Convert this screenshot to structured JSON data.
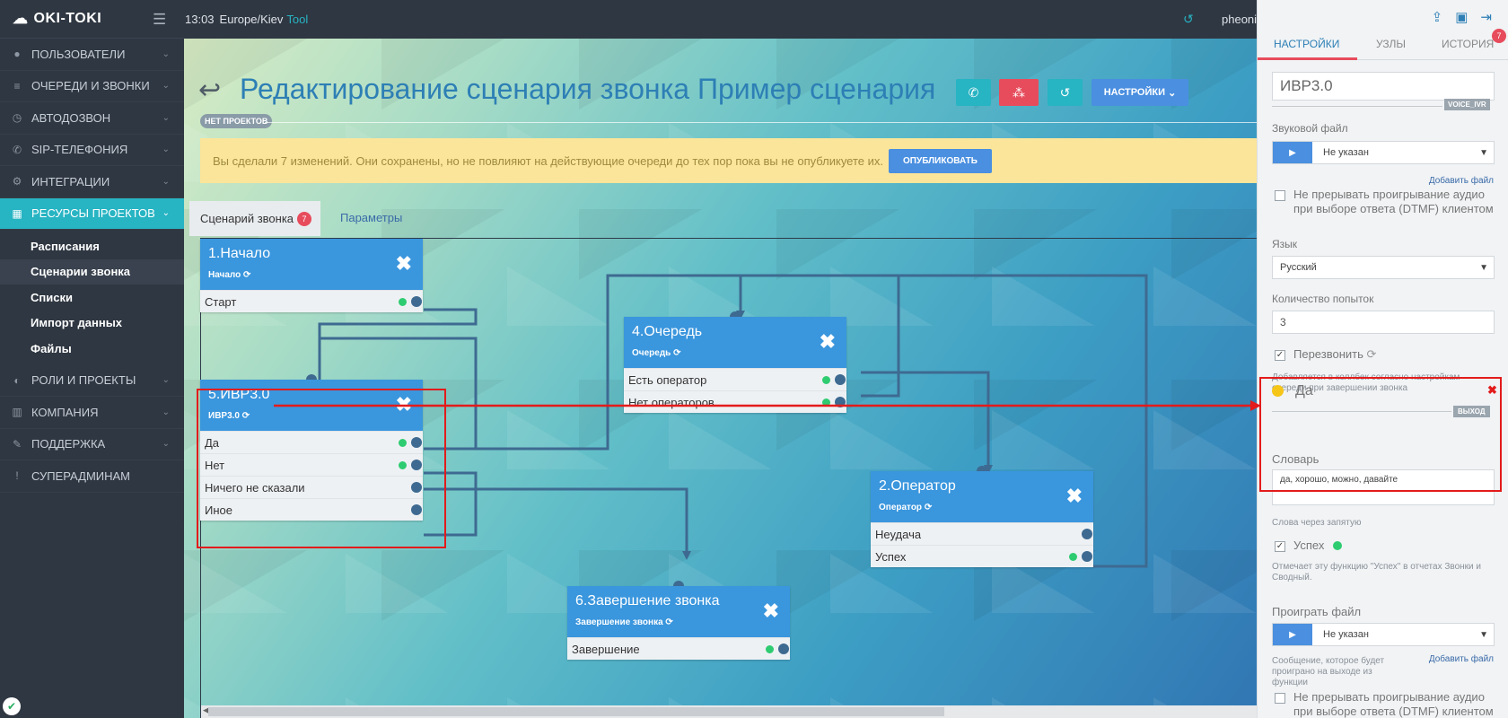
{
  "brand": "OKI-TOKI",
  "topbar": {
    "time": "13:03",
    "timezone": "Europe/Kiev",
    "tool": "Tool",
    "user": "pheoni"
  },
  "sidebar": {
    "items": [
      {
        "label": "ПОЛЬЗОВАТЕЛИ",
        "icon": "user-icon"
      },
      {
        "label": "ОЧЕРЕДИ И ЗВОНКИ",
        "icon": "list-icon"
      },
      {
        "label": "АВТОДОЗВОН",
        "icon": "clock-icon"
      },
      {
        "label": "SIP-ТЕЛЕФОНИЯ",
        "icon": "phone-icon"
      },
      {
        "label": "ИНТЕГРАЦИИ",
        "icon": "cogs-icon"
      },
      {
        "label": "РЕСУРСЫ ПРОЕКТОВ",
        "icon": "grid-icon",
        "active": true
      },
      {
        "label": "РОЛИ И ПРОЕКТЫ",
        "icon": "toggle-icon"
      },
      {
        "label": "КОМПАНИЯ",
        "icon": "chart-icon"
      },
      {
        "label": "ПОДДЕРЖКА",
        "icon": "wrench-icon"
      },
      {
        "label": "СУПЕРАДМИНАМ",
        "icon": "exclamation-icon"
      }
    ],
    "subitems": [
      "Расписания",
      "Сценарии звонка",
      "Списки",
      "Импорт данных",
      "Файлы"
    ]
  },
  "main": {
    "title": "Редактирование сценария звонка Пример сценария",
    "settings_button": "НАСТРОЙКИ",
    "project_tag": "НЕТ ПРОЕКТОВ",
    "notice": "Вы сделали 7 изменений. Они сохранены, но не повлияют на действующие очереди до тех пор пока вы не опубликуете их.",
    "publish_button": "ОПУБЛИКОВАТЬ",
    "tabs": {
      "scenario": "Сценарий звонка",
      "scenario_badge": "7",
      "params": "Параметры"
    }
  },
  "nodes": {
    "n1": {
      "title": "1.Начало",
      "sub": "Начало",
      "rows": [
        "Старт"
      ]
    },
    "n5": {
      "title": "5.ИВР3.0",
      "sub": "ИВР3.0",
      "rows": [
        "Да",
        "Нет",
        "Ничего не сказали",
        "Иное"
      ]
    },
    "n4": {
      "title": "4.Очередь",
      "sub": "Очередь",
      "rows": [
        "Есть оператор",
        "Нет операторов"
      ]
    },
    "n2": {
      "title": "2.Оператор",
      "sub": "Оператор",
      "rows": [
        "Неудача",
        "Успех"
      ]
    },
    "n6": {
      "title": "6.Завершение звонка",
      "sub": "Завершение звонка",
      "rows": [
        "Завершение"
      ]
    }
  },
  "panel": {
    "tabs": {
      "settings": "НАСТРОЙКИ",
      "nodes": "УЗЛЫ",
      "history": "ИСТОРИЯ",
      "history_badge": "7"
    },
    "name": "ИВР3.0",
    "type_tag": "VOICE_IVR",
    "sound_label": "Звуковой файл",
    "sound_value": "Не указан",
    "add_file": "Добавить файл",
    "no_interrupt": "Не прерывать проигрывание аудио при выборе ответа (DTMF) клиентом",
    "lang_label": "Язык",
    "lang_value": "Русский",
    "attempts_label": "Количество попыток",
    "attempts_value": "3",
    "callback": "Перезвонить",
    "callback_hint": "Добавляется в коллбек согласно настройкам очереди при завершении звонка",
    "exit_name": "Да",
    "exit_tag": "ВЫХОД",
    "dict_label": "Словарь",
    "dict_value": "да, хорошо, можно, давайте",
    "dict_hint": "Слова через запятую",
    "success": "Успех",
    "success_hint": "Отмечает эту функцию \"Успех\" в отчетах Звонки и Сводный.",
    "play_label": "Проиграть файл",
    "play_value": "Не указан",
    "play_hint": "Сообщение, которое будет проиграно на выходе из функции",
    "add_file2": "Добавить файл",
    "no_interrupt2": "Не прерывать проигрывание аудио при выборе ответа (DTMF) клиентом"
  }
}
